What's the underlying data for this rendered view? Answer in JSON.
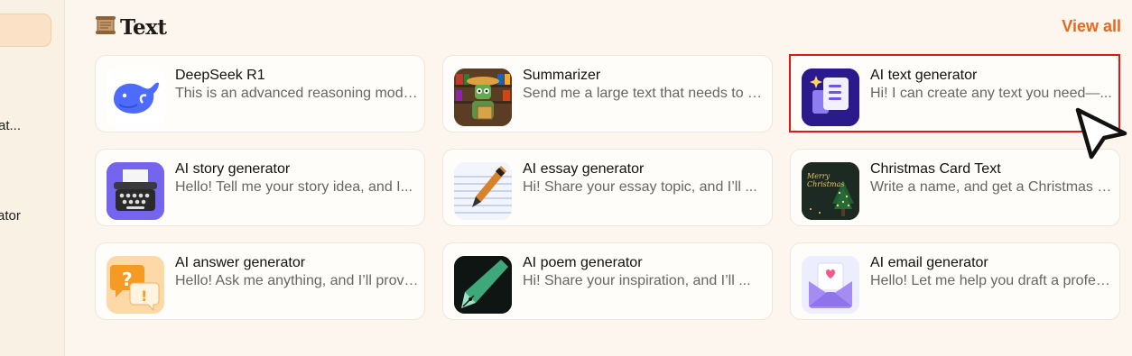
{
  "sidebar": {
    "items": [
      {
        "label": "at..."
      },
      {
        "label": "ator"
      }
    ]
  },
  "section": {
    "title": "Text",
    "icon": "scroll-icon",
    "view_all": "View all"
  },
  "cards": [
    {
      "name": "DeepSeek R1",
      "desc": "This is an advanced reasoning model...",
      "icon": "deepseek-whale-icon"
    },
    {
      "name": "Summarizer",
      "desc": "Send me a large text that needs to be summarized",
      "icon": "robot-reading-icon"
    },
    {
      "name": "AI text generator",
      "desc": "Hi! I can create any text you need—...",
      "icon": "document-sparkle-icon"
    },
    {
      "name": "AI story generator",
      "desc": "Hello! Tell me your story idea, and I...",
      "icon": "typewriter-icon"
    },
    {
      "name": "AI essay generator",
      "desc": "Hi! Share your essay topic, and I’ll ...",
      "icon": "pen-paper-icon"
    },
    {
      "name": "Christmas Card Text",
      "desc": "Write a name, and get a Christmas card text",
      "icon": "christmas-card-icon",
      "thumb_text": [
        "Merry",
        "Christmas"
      ]
    },
    {
      "name": "AI answer generator",
      "desc": "Hello! Ask me anything, and I’ll provide an answer",
      "icon": "question-bubbles-icon"
    },
    {
      "name": "AI poem generator",
      "desc": "Hi! Share your inspiration, and I’ll ...",
      "icon": "fountain-pen-icon"
    },
    {
      "name": "AI email generator",
      "desc": "Hello! Let me help you draft a professional email",
      "icon": "envelope-heart-icon"
    }
  ],
  "colors": {
    "accent": "#e8671d",
    "highlight": "#e11717",
    "background": "#fcf6ee"
  }
}
